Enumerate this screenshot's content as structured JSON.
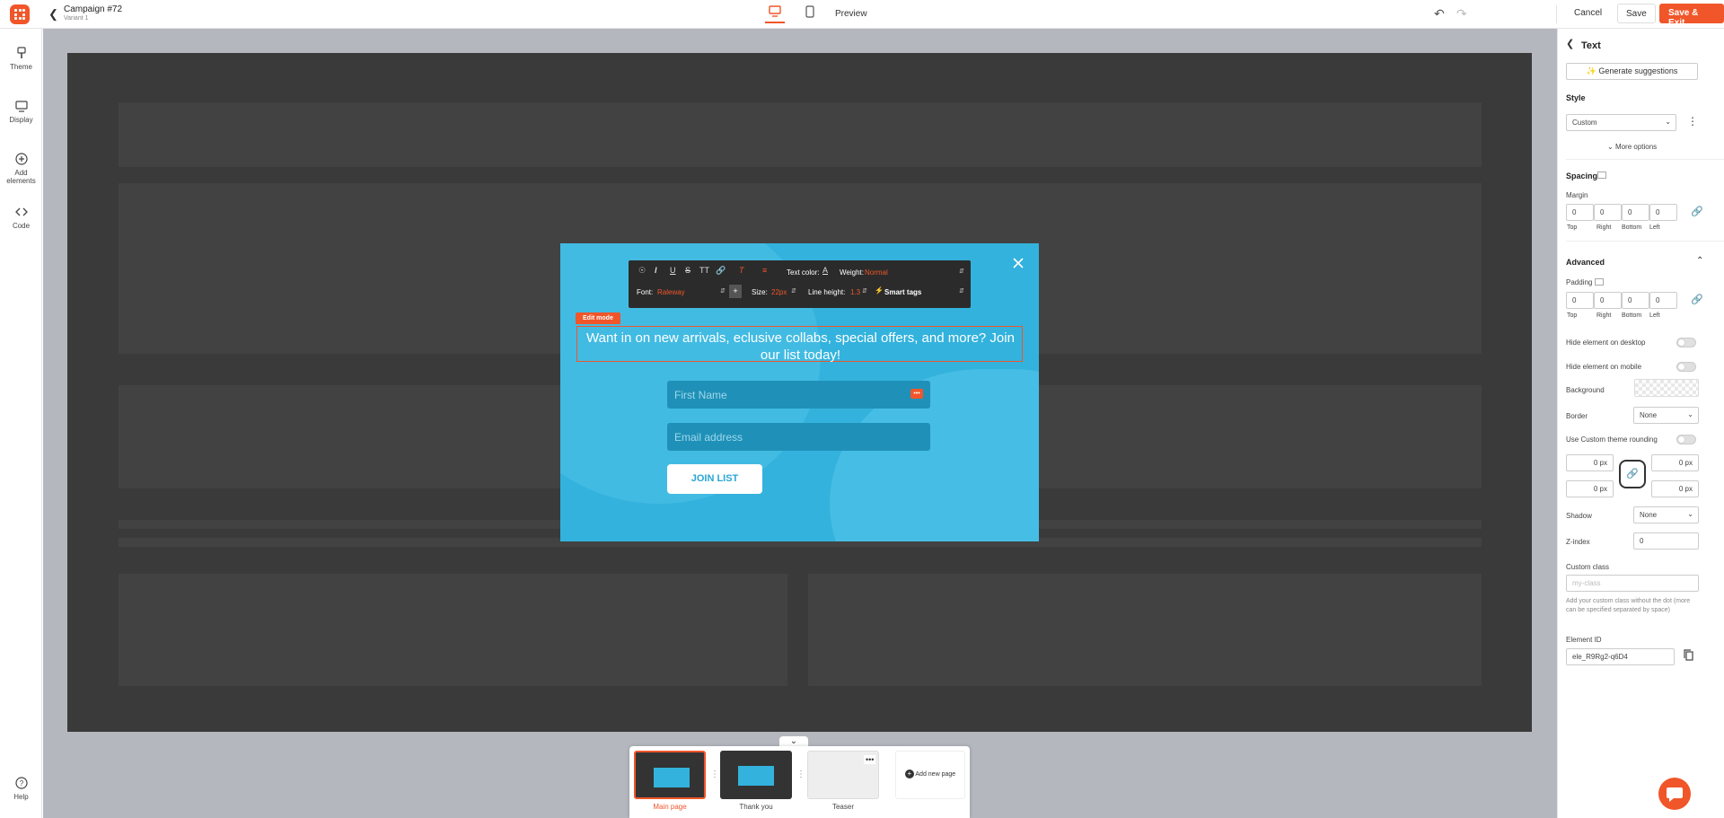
{
  "header": {
    "campaign_title": "Campaign #72",
    "variant": "Variant 1",
    "preview_label": "Preview",
    "cancel_label": "Cancel",
    "save_label": "Save",
    "save_exit_label": "Save & Exit"
  },
  "sidebar": {
    "items": [
      {
        "label": "Theme",
        "icon": "brush-icon"
      },
      {
        "label": "Display",
        "icon": "monitor-icon"
      },
      {
        "label": "Add elements",
        "icon": "plus-circle-icon"
      },
      {
        "label": "Code",
        "icon": "code-icon"
      }
    ],
    "help_label": "Help"
  },
  "popup": {
    "edit_mode_label": "Edit mode",
    "headline": "Want in on new arrivals, eclusive collabs, special offers, and more? Join our list today!",
    "first_name_placeholder": "First Name",
    "email_placeholder": "Email address",
    "join_label": "JOIN LIST",
    "colors": {
      "background": "#33b2dd",
      "accent": "#f0562a"
    }
  },
  "toolbar": {
    "text_color_label": "Text color:",
    "weight_label": "Weight:",
    "weight_value": "Normal",
    "font_label": "Font:",
    "font_value": "Raleway",
    "size_label": "Size:",
    "size_value": "22px",
    "line_height_label": "Line height:",
    "line_height_value": "1.3",
    "smart_tags_label": "Smart tags"
  },
  "pages": [
    {
      "label": "Main page"
    },
    {
      "label": "Thank you"
    },
    {
      "label": "Teaser"
    }
  ],
  "add_page_label": "Add new page",
  "panel": {
    "title": "Text",
    "generate_label": "Generate suggestions",
    "style_label": "Style",
    "style_value": "Custom",
    "more_options_label": "More options",
    "spacing_label": "Spacing",
    "margin_label": "Margin",
    "margin_values": [
      "0",
      "0",
      "0",
      "0"
    ],
    "side_labels": [
      "Top",
      "Right",
      "Bottom",
      "Left"
    ],
    "advanced_label": "Advanced",
    "padding_label": "Padding",
    "padding_values": [
      "0",
      "0",
      "0",
      "0"
    ],
    "hide_desktop_label": "Hide element on desktop",
    "hide_mobile_label": "Hide element on mobile",
    "background_label": "Background",
    "border_label": "Border",
    "border_value": "None",
    "custom_rounding_label": "Use Custom theme rounding",
    "radius_values": [
      "0 px",
      "0 px",
      "0 px",
      "0 px"
    ],
    "shadow_label": "Shadow",
    "shadow_value": "None",
    "zindex_label": "Z-index",
    "zindex_value": "0",
    "custom_class_label": "Custom class",
    "custom_class_placeholder": "my-class",
    "custom_class_help": "Add your custom class without the dot (more can be specified separated by space)",
    "element_id_label": "Element ID",
    "element_id_value": "ele_R9Rg2-q6D4"
  }
}
